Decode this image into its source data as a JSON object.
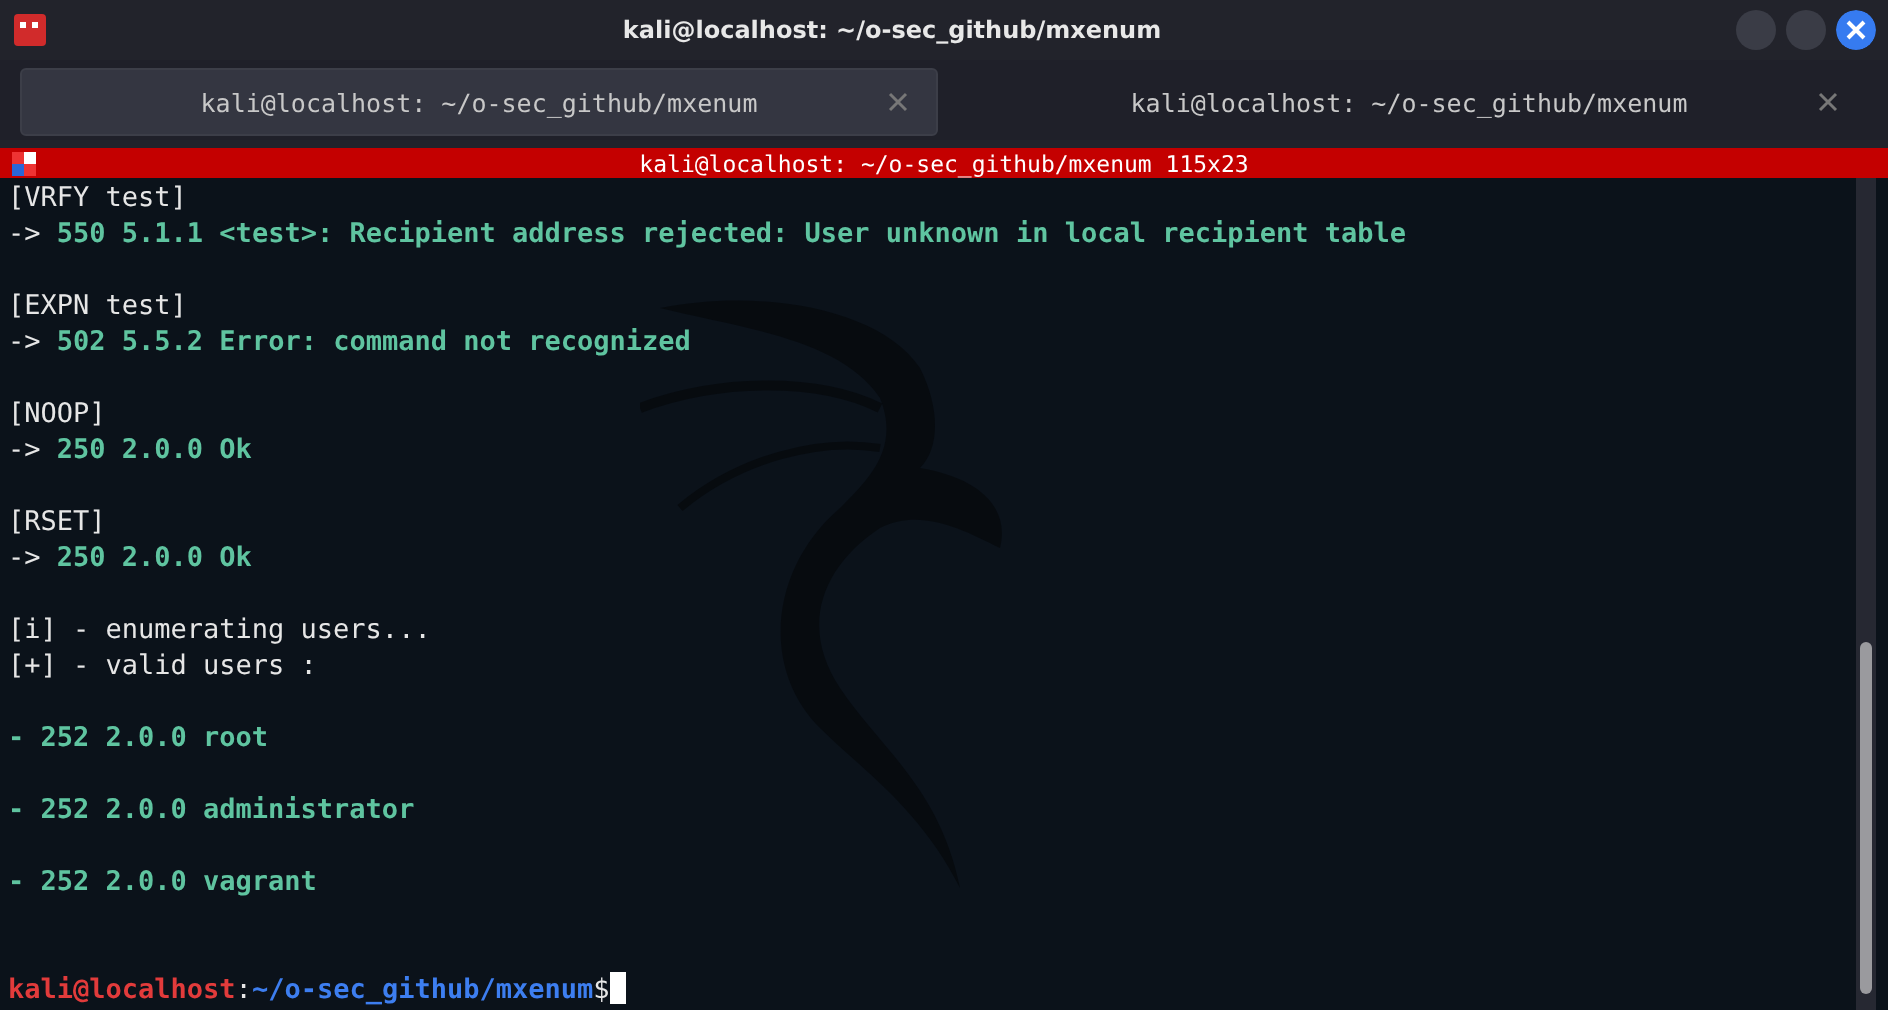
{
  "window": {
    "title": "kali@localhost: ~/o-sec_github/mxenum"
  },
  "tabs": [
    {
      "label": "kali@localhost: ~/o-sec_github/mxenum",
      "selected": true
    },
    {
      "label": "kali@localhost: ~/o-sec_github/mxenum",
      "selected": false
    }
  ],
  "terminal_title": "kali@localhost: ~/o-sec_github/mxenum 115x23",
  "lines": [
    {
      "kind": "plain",
      "text": "[VRFY test]"
    },
    {
      "kind": "reply",
      "prefix": "->",
      "text": "550 5.1.1 <test>: Recipient address rejected: User unknown in local recipient table"
    },
    {
      "kind": "blank"
    },
    {
      "kind": "plain",
      "text": "[EXPN test]"
    },
    {
      "kind": "reply",
      "prefix": "->",
      "text": "502 5.5.2 Error: command not recognized"
    },
    {
      "kind": "blank"
    },
    {
      "kind": "plain",
      "text": "[NOOP]"
    },
    {
      "kind": "reply",
      "prefix": "->",
      "text": "250 2.0.0 Ok"
    },
    {
      "kind": "blank"
    },
    {
      "kind": "plain",
      "text": "[RSET]"
    },
    {
      "kind": "reply",
      "prefix": "->",
      "text": "250 2.0.0 Ok"
    },
    {
      "kind": "blank"
    },
    {
      "kind": "plain",
      "text": "[i] - enumerating users..."
    },
    {
      "kind": "plain",
      "text": "[+] - valid users :"
    },
    {
      "kind": "blank"
    },
    {
      "kind": "found",
      "text": "- 252 2.0.0 root"
    },
    {
      "kind": "blank"
    },
    {
      "kind": "found",
      "text": "- 252 2.0.0 administrator"
    },
    {
      "kind": "blank"
    },
    {
      "kind": "found",
      "text": "- 252 2.0.0 vagrant"
    },
    {
      "kind": "blank"
    },
    {
      "kind": "blank"
    }
  ],
  "prompt": {
    "user": "kali@localhost",
    "separator": ":",
    "path": "~/o-sec_github/mxenum",
    "symbol": "$"
  }
}
